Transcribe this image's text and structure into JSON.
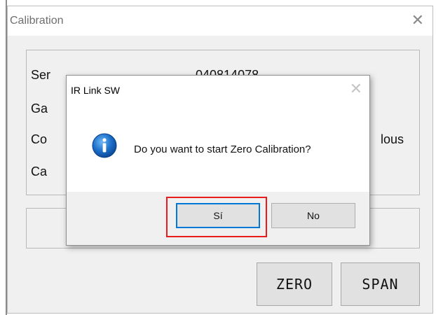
{
  "calibration_window": {
    "title": "Calibration",
    "rows": [
      {
        "label": "Ser",
        "value": "040814078"
      },
      {
        "label": "Ga",
        "value": ""
      },
      {
        "label": "Co",
        "value": "lous"
      },
      {
        "label": "Ca",
        "value": ""
      }
    ],
    "buttons": {
      "zero": "ZERO",
      "span": "SPAN"
    }
  },
  "dialog": {
    "title": "IR Link SW",
    "message": "Do you want to start Zero Calibration?",
    "yes_label": "Sí",
    "no_label": "No",
    "icon": "info-icon"
  },
  "highlight": {
    "target": "yes-button",
    "color": "#e81c1c"
  },
  "colors": {
    "window_bg": "#f0f0f0",
    "button_bg": "#e1e1e1",
    "default_focus": "#0078d7",
    "info_icon_blue": "#1b6fc9"
  }
}
